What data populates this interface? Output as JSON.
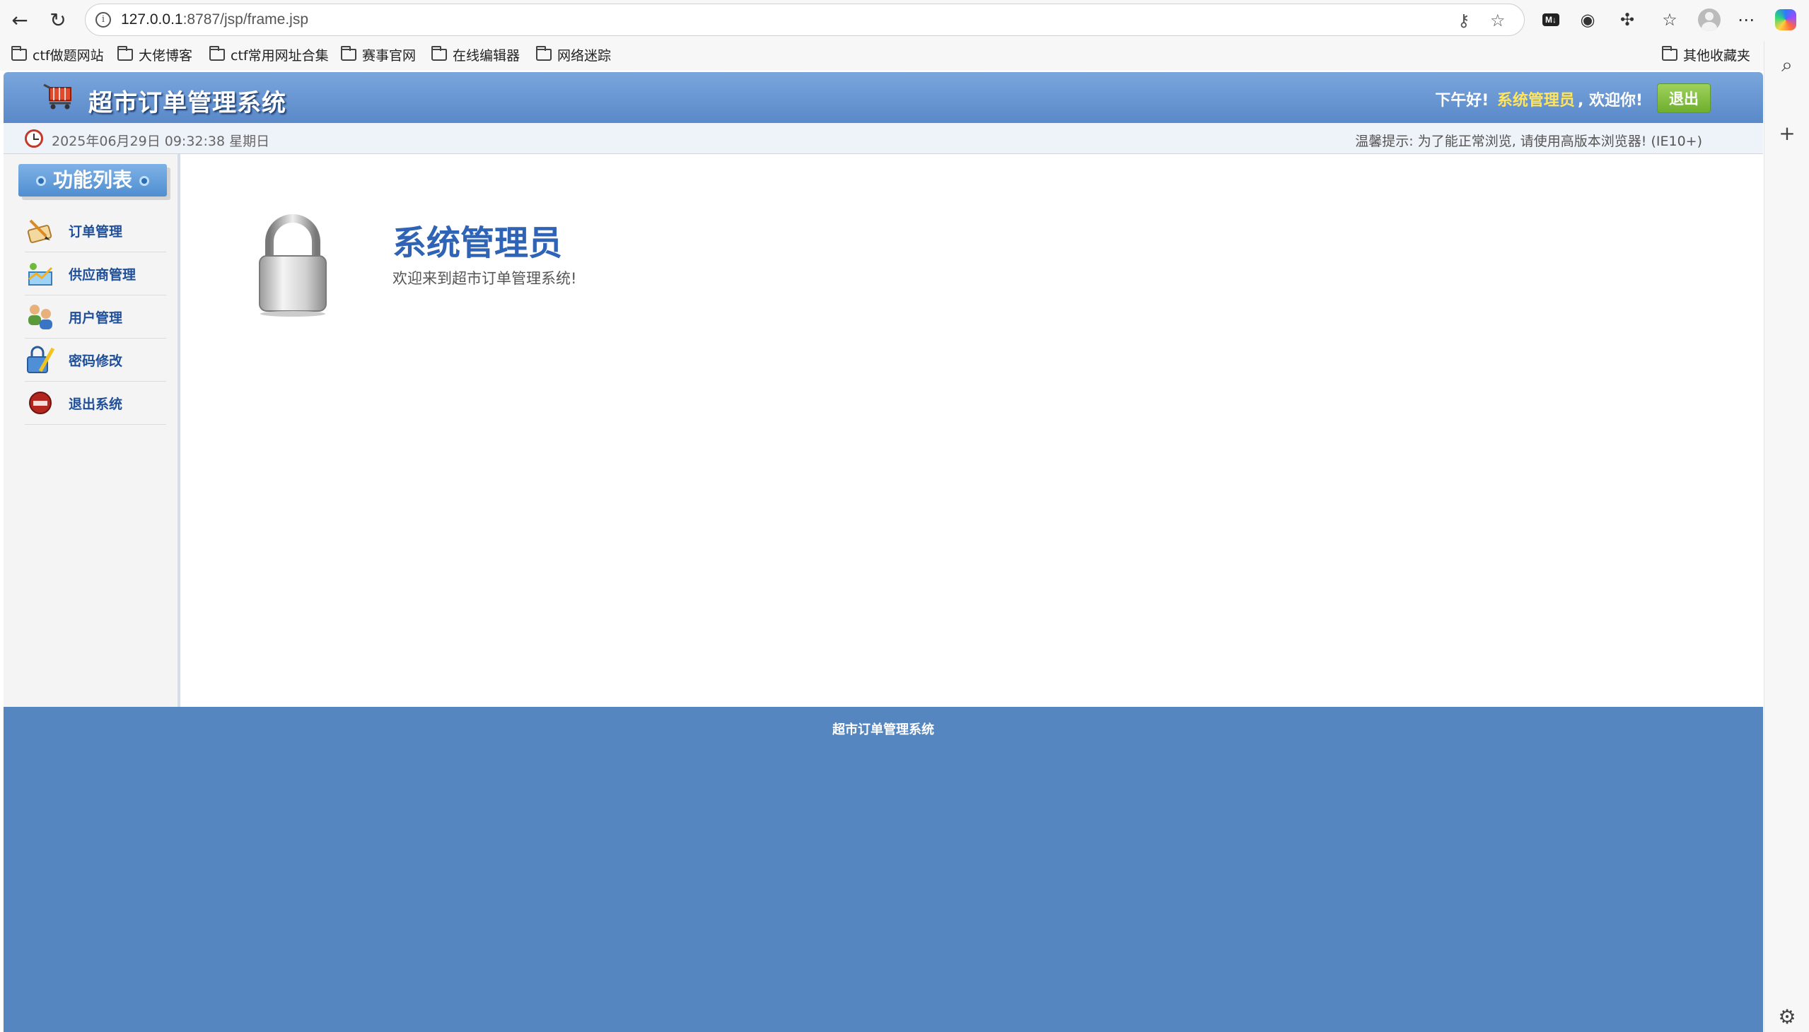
{
  "browser": {
    "url_host": "127.0.0.1",
    "url_path": ":8787/jsp/frame.jsp",
    "bookmarks": [
      "ctf做题网站",
      "大佬博客",
      "ctf常用网址合集",
      "赛事官网",
      "在线编辑器",
      "网络迷踪"
    ],
    "other_bookmarks": "其他收藏夹",
    "icons": [
      "back-icon",
      "refresh-icon",
      "info-icon",
      "key-icon",
      "star-icon",
      "markdown-icon",
      "record-icon",
      "extensions-icon",
      "favorites-icon",
      "profile-icon",
      "more-icon",
      "copilot-icon",
      "search-icon",
      "plus-icon",
      "settings-icon"
    ]
  },
  "header": {
    "title": "超市订单管理系统",
    "greeting_prefix": "下午好!",
    "username": "系统管理员",
    "greeting_suffix": ", 欢迎你!",
    "logout_label": "退出"
  },
  "info_bar": {
    "datetime": "2025年06月29日 09:32:38 星期日",
    "tip": "温馨提示: 为了能正常浏览, 请使用高版本浏览器! (IE10+)"
  },
  "sidebar": {
    "title": "功能列表",
    "items": [
      {
        "label": "订单管理",
        "icon": "order-icon"
      },
      {
        "label": "供应商管理",
        "icon": "supplier-icon"
      },
      {
        "label": "用户管理",
        "icon": "users-icon"
      },
      {
        "label": "密码修改",
        "icon": "password-icon"
      },
      {
        "label": "退出系统",
        "icon": "exit-icon"
      }
    ]
  },
  "main": {
    "admin_title": "系统管理员",
    "welcome": "欢迎来到超市订单管理系统!"
  },
  "footer": {
    "text": "超市订单管理系统"
  },
  "colors": {
    "header_blue": "#5a89c9",
    "footer_blue": "#5586bf",
    "username_yellow": "#ffe45c",
    "logout_green": "#7cbd3a",
    "menu_text": "#1f4f99",
    "title_blue": "#2f63b5"
  }
}
